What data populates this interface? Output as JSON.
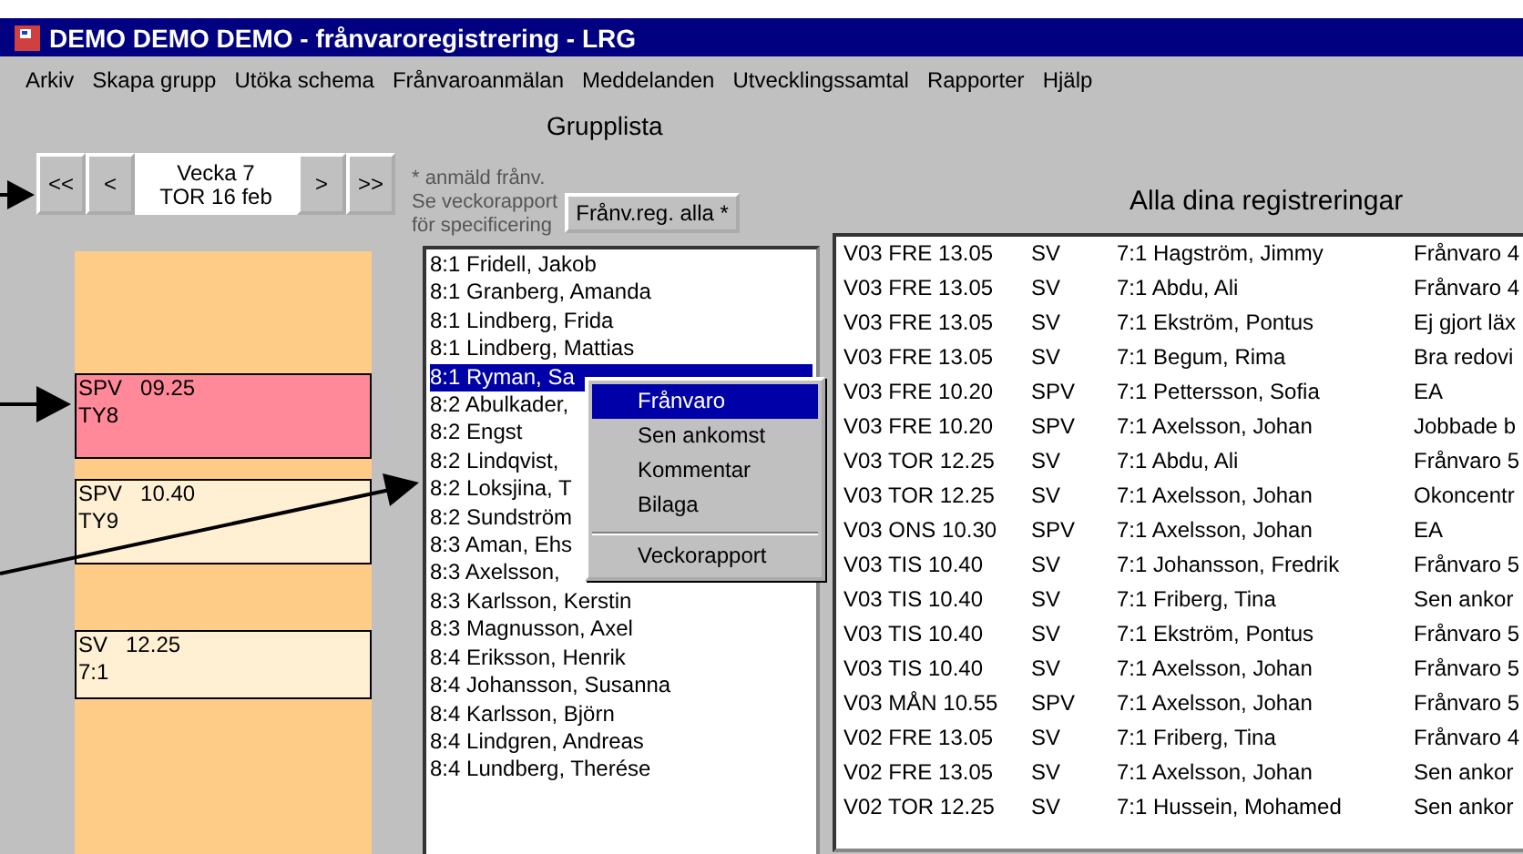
{
  "window": {
    "title": "DEMO DEMO DEMO - frånvaroregistrering - LRG"
  },
  "menu": [
    "Arkiv",
    "Skapa grupp",
    "Utöka schema",
    "Frånvaroanmälan",
    "Meddelanden",
    "Utvecklingssamtal",
    "Rapporter",
    "Hjälp"
  ],
  "week_nav": {
    "first": "<<",
    "prev": "<",
    "week": "Vecka  7",
    "day": "TOR 16 feb",
    "next": ">",
    "last": ">>"
  },
  "group_list": {
    "title": "Grupplista",
    "note": "* anmäld frånv.\nSe veckorapport\nför specificering",
    "button": "Frånv.reg. alla *",
    "items": [
      {
        "text": "8:1 Fridell, Jakob",
        "selected": false
      },
      {
        "text": "8:1 Granberg, Amanda",
        "selected": false
      },
      {
        "text": "8:1 Lindberg, Frida",
        "selected": false
      },
      {
        "text": "8:1 Lindberg, Mattias",
        "selected": false
      },
      {
        "text": "8:1 Ryman, Sa",
        "selected": true
      },
      {
        "text": "8:2 Abulkader,",
        "selected": false
      },
      {
        "text": "8:2 Engst",
        "selected": false
      },
      {
        "text": "8:2 Lindqvist, ",
        "selected": false
      },
      {
        "text": "8:2 Loksjina, T",
        "selected": false
      },
      {
        "text": "8:2 Sundström",
        "selected": false
      },
      {
        "text": "8:3 Aman, Ehs",
        "selected": false
      },
      {
        "text": "8:3 Axelsson, ",
        "selected": false
      },
      {
        "text": "8:3 Karlsson, Kerstin",
        "selected": false
      },
      {
        "text": "8:3 Magnusson, Axel",
        "selected": false
      },
      {
        "text": "8:4 Eriksson, Henrik",
        "selected": false
      },
      {
        "text": "8:4 Johansson, Susanna",
        "selected": false
      },
      {
        "text": "8:4 Karlsson, Björn",
        "selected": false
      },
      {
        "text": "8:4 Lindgren, Andreas",
        "selected": false
      },
      {
        "text": "8:4 Lundberg, Therése",
        "selected": false
      }
    ]
  },
  "context_menu": [
    {
      "label": "Frånvaro",
      "selected": true,
      "separator_before": false
    },
    {
      "label": "Sen ankomst",
      "selected": false,
      "separator_before": false
    },
    {
      "label": "Kommentar",
      "selected": false,
      "separator_before": false
    },
    {
      "label": "Bilaga",
      "selected": false,
      "separator_before": false
    },
    {
      "label": "Veckorapport",
      "selected": false,
      "separator_before": true
    }
  ],
  "schedule": [
    {
      "subject": "SPV",
      "time": "09.25",
      "group": "TY8",
      "selected": true
    },
    {
      "subject": "SPV",
      "time": "10.40",
      "group": "TY9",
      "selected": false
    },
    {
      "subject": "SV",
      "time": "12.25",
      "group": "7:1",
      "selected": false
    }
  ],
  "registrations": {
    "title": "Alla dina registreringar",
    "rows": [
      [
        "V03 FRE 13.05",
        "SV",
        "7:1 Hagström, Jimmy",
        "Frånvaro 4"
      ],
      [
        "V03 FRE 13.05",
        "SV",
        "7:1 Abdu, Ali",
        "Frånvaro 4"
      ],
      [
        "V03 FRE 13.05",
        "SV",
        "7:1 Ekström, Pontus",
        "Ej gjort läx"
      ],
      [
        "V03 FRE 13.05",
        "SV",
        "7:1 Begum, Rima",
        "Bra redovi"
      ],
      [
        "V03 FRE 10.20",
        "SPV",
        "7:1 Pettersson, Sofia",
        "EA"
      ],
      [
        "V03 FRE 10.20",
        "SPV",
        "7:1 Axelsson, Johan",
        "Jobbade b"
      ],
      [
        "V03 TOR 12.25",
        "SV",
        "7:1 Abdu, Ali",
        "Frånvaro 5"
      ],
      [
        "V03 TOR 12.25",
        "SV",
        "7:1 Axelsson, Johan",
        "Okoncentr"
      ],
      [
        "V03 ONS 10.30",
        "SPV",
        "7:1 Axelsson, Johan",
        "EA"
      ],
      [
        "V03 TIS 10.40",
        "SV",
        "7:1 Johansson, Fredrik",
        "Frånvaro 5"
      ],
      [
        "V03 TIS 10.40",
        "SV",
        "7:1 Friberg, Tina",
        "Sen ankor"
      ],
      [
        "V03 TIS 10.40",
        "SV",
        "7:1 Ekström, Pontus",
        "Frånvaro 5"
      ],
      [
        "V03 TIS 10.40",
        "SV",
        "7:1 Axelsson, Johan",
        "Frånvaro 5"
      ],
      [
        "V03 MÅN 10.55",
        "SPV",
        "7:1 Axelsson, Johan",
        "Frånvaro 5"
      ],
      [
        "V02 FRE 13.05",
        "SV",
        "7:1 Friberg, Tina",
        "Frånvaro 4"
      ],
      [
        "V02 FRE 13.05",
        "SV",
        "7:1 Axelsson, Johan",
        "Sen ankor"
      ],
      [
        "V02 TOR 12.25",
        "SV",
        "7:1 Hussein, Mohamed",
        "Sen ankor"
      ]
    ]
  }
}
